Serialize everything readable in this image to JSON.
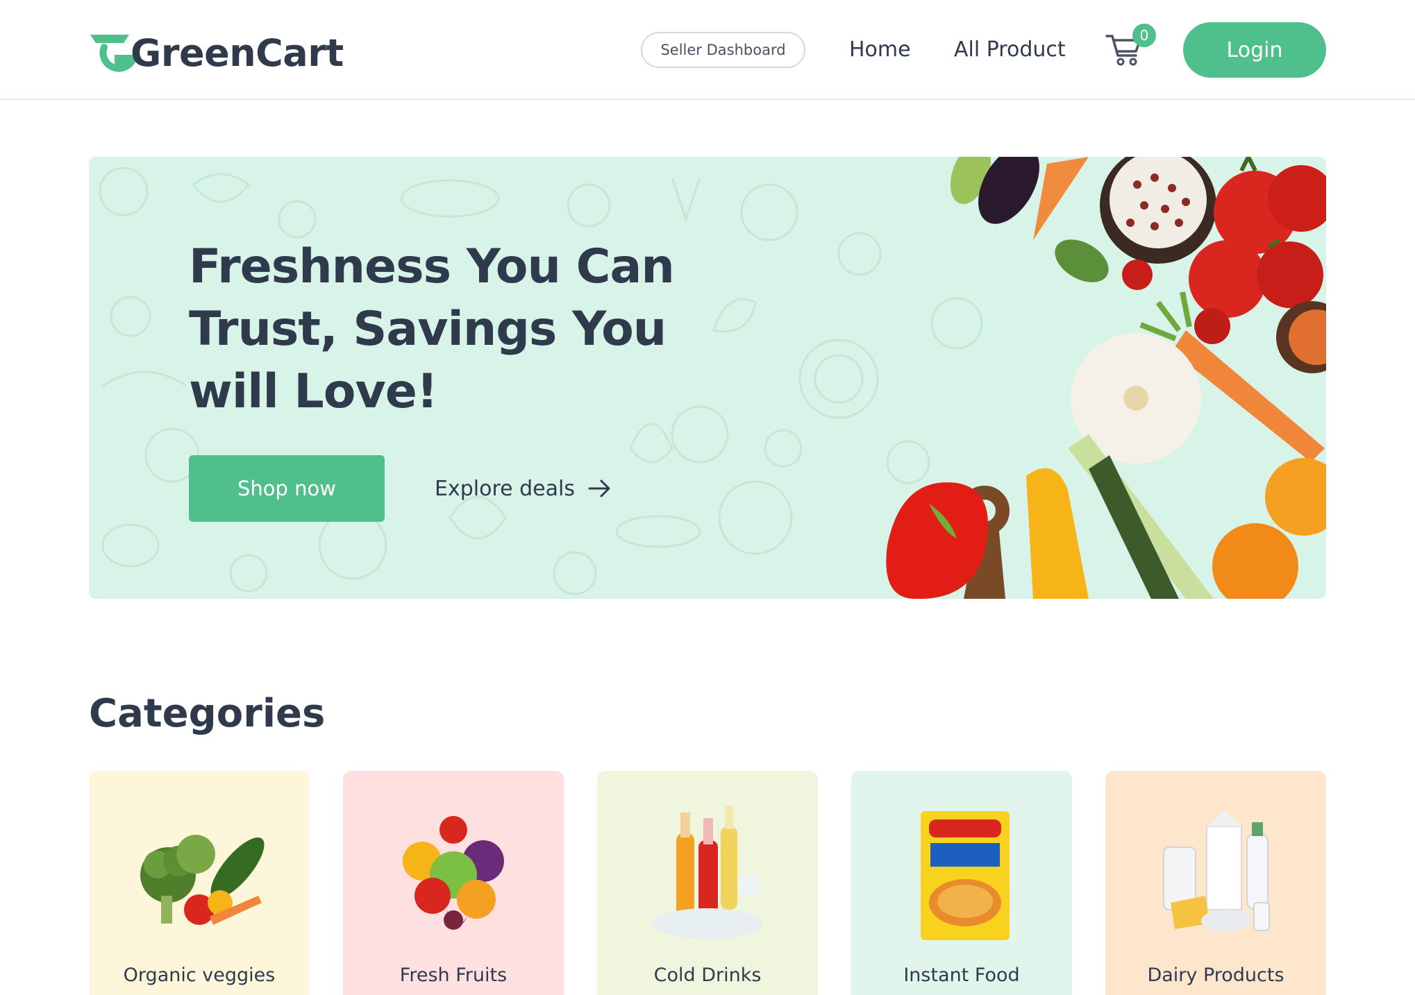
{
  "header": {
    "logo_text": "GreenCart",
    "seller_dashboard_label": "Seller Dashboard",
    "nav": [
      {
        "label": "Home"
      },
      {
        "label": "All Product"
      }
    ],
    "cart_icon": "cart-icon",
    "cart_count": "0",
    "login_label": "Login"
  },
  "hero": {
    "title": "Freshness You Can Trust, Savings You will Love!",
    "shop_label": "Shop now",
    "explore_label": "Explore deals",
    "explore_icon": "arrow-right-icon",
    "background_color": "#d8f3e7"
  },
  "categories": {
    "title": "Categories",
    "items": [
      {
        "label": "Organic veggies",
        "bg": "#fef6da"
      },
      {
        "label": "Fresh Fruits",
        "bg": "#fee0e0"
      },
      {
        "label": "Cold Drinks",
        "bg": "#f0f5de"
      },
      {
        "label": "Instant Food",
        "bg": "#e1f5ec"
      },
      {
        "label": "Dairy Products",
        "bg": "#fee6cd"
      }
    ]
  },
  "colors": {
    "accent": "#4fbf8b",
    "text": "#2f3a4d"
  }
}
